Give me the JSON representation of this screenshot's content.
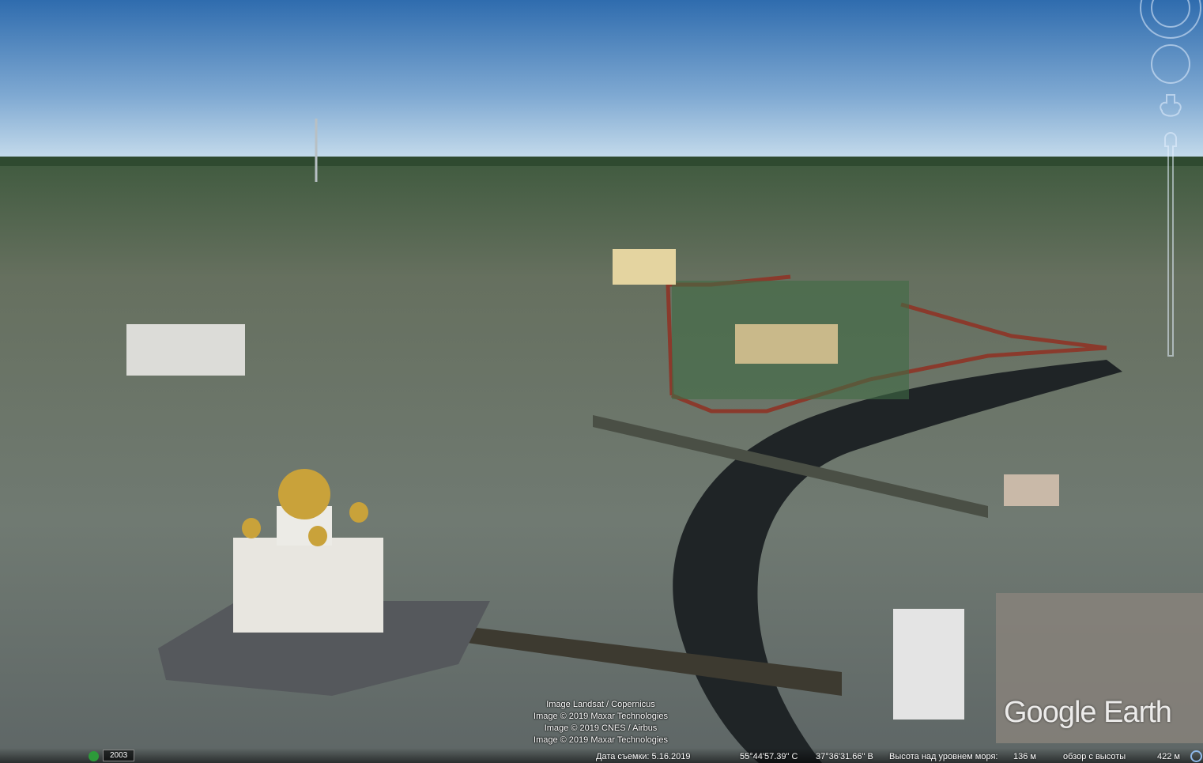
{
  "view": {
    "type": "3D aerial view of central Moscow"
  },
  "attribution": [
    "Image Landsat / Copernicus",
    "Image © 2019 Maxar Technologies",
    "Image © 2019 CNES / Airbus",
    "Image © 2019 Maxar Technologies"
  ],
  "logo": "Google Earth",
  "status": {
    "history_year": "2003",
    "date_label": "Дата съемки: 5.16.2019",
    "lat": "55°44'57.39\" С",
    "lon": "37°36'31.66\" В",
    "elevation_label": "Высота над уровнем моря:",
    "elevation_value": "136 м",
    "eye_alt_label": "обзор с высоты",
    "eye_alt_value": "422 м"
  },
  "colors": {
    "sky_top": "#2f6cae",
    "sky_horizon": "#c6dcec",
    "river": "#1f2426",
    "ground": "#5b6a5c"
  }
}
